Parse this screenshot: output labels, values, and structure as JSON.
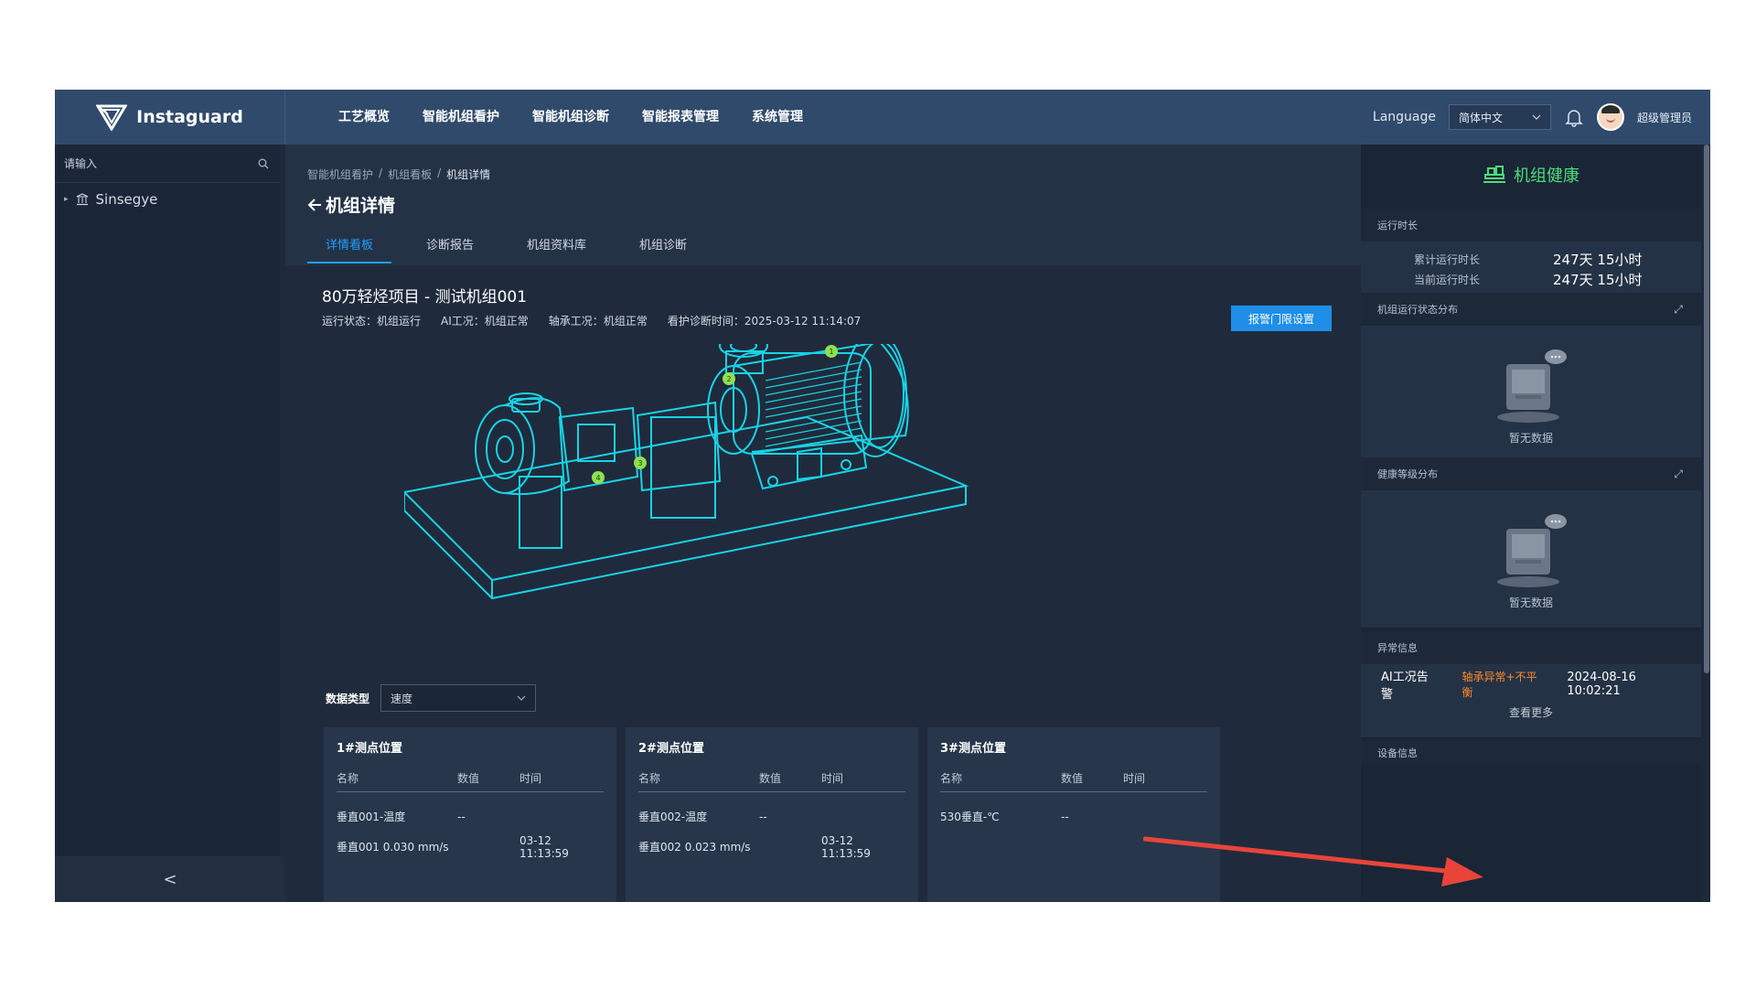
{
  "header": {
    "brand": "Instaguard",
    "nav": [
      "工艺概览",
      "智能机组看护",
      "智能机组诊断",
      "智能报表管理",
      "系统管理"
    ],
    "language_label": "Language",
    "language_value": "简体中文",
    "user_name": "超级管理员"
  },
  "sidebar": {
    "search_placeholder": "请输入",
    "tree": [
      {
        "label": "Sinsegye"
      }
    ],
    "collapse_glyph": "<"
  },
  "main": {
    "breadcrumb": [
      "智能机组看护",
      "机组看板",
      "机组详情"
    ],
    "title": "机组详情",
    "tabs": [
      "详情看板",
      "诊断报告",
      "机组资料库",
      "机组诊断"
    ],
    "active_tab": 0,
    "unit_title": "80万轻烃项目 - 测试机组001",
    "status": [
      {
        "label": "运行状态：",
        "value": "机组运行"
      },
      {
        "label": "AI工况：",
        "value": "机组正常"
      },
      {
        "label": "轴承工况：",
        "value": "机组正常"
      },
      {
        "label": "看护诊断时间：",
        "value": "2025-03-12 11:14:07"
      }
    ],
    "alarm_button": "报警门限设置",
    "data_type_label": "数据类型",
    "data_type_value": "速度",
    "sensor_markers": [
      "1",
      "2",
      "3",
      "4"
    ],
    "cards": [
      {
        "title": "1#测点位置",
        "headers": [
          "名称",
          "数值",
          "时间"
        ],
        "rows": [
          [
            "垂直001-温度",
            "--",
            ""
          ],
          [
            "垂直001  0.030 mm/s",
            "",
            "03-12 11:13:59"
          ]
        ]
      },
      {
        "title": "2#测点位置",
        "headers": [
          "名称",
          "数值",
          "时间"
        ],
        "rows": [
          [
            "垂直002-温度",
            "--",
            ""
          ],
          [
            "垂直002  0.023 mm/s",
            "",
            "03-12 11:13:59"
          ]
        ]
      },
      {
        "title": "3#测点位置",
        "headers": [
          "名称",
          "数值",
          "时间"
        ],
        "rows": [
          [
            "530垂直-℃",
            "--",
            ""
          ]
        ]
      }
    ]
  },
  "right_panel": {
    "health_title": "机组健康",
    "runtime_section": "运行时长",
    "runtime": [
      {
        "label": "累计运行时长",
        "value": "247天 15小时"
      },
      {
        "label": "当前运行时长",
        "value": "247天 15小时"
      }
    ],
    "state_dist_section": "机组运行状态分布",
    "health_dist_section": "健康等级分布",
    "empty_text": "暂无数据",
    "anomaly_section": "异常信息",
    "anomaly": {
      "source": "AI工况告警",
      "type": "轴承异常+不平衡",
      "time": "2024-08-16 10:02:21"
    },
    "more_link": "查看更多",
    "device_section": "设备信息"
  },
  "colors": {
    "accent": "#1e9fff",
    "header_bg": "#2f4a6b",
    "health_green": "#4ddb7a",
    "warning_orange": "#ff8a2b",
    "wireframe_cyan": "#19d3e6",
    "annotation_arrow": "#e8443a"
  }
}
